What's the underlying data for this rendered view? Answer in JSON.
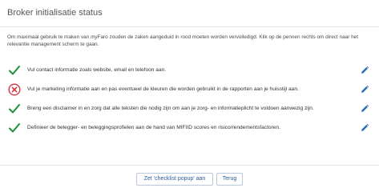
{
  "dialog": {
    "title": "Broker initialisatie status",
    "intro": "Om maximaal gebruik te maken van myFaro zouden de zaken aangeduid in rood moeten worden vervolledigd. Klik op de pennen rechts om direct naar het relevantie management scherm te gaan."
  },
  "checklist": {
    "items": [
      {
        "status": "done",
        "status_icon": "check-icon",
        "text": "Vul contact informatie zoals website, email en telefoon aan."
      },
      {
        "status": "missing",
        "status_icon": "error-circle-icon",
        "text": "Vul je marketing informatie aan en pas eventueel de kleuren die worden gebruikt in de rapporten aan je huisstijl aan."
      },
      {
        "status": "done",
        "status_icon": "check-icon",
        "text": "Breng een disclaimer in en zorg dat alle teksten die nodig zijn om aan je zorg- en informatieplicht te voldoen aanwezig zijn."
      },
      {
        "status": "done",
        "status_icon": "check-icon",
        "text": "Definieer de belegger- en beleggingsprofielen aan de hand van MIFIID scores en risico/rendementsfactoren."
      }
    ]
  },
  "footer": {
    "checklist_button": "Zet 'checklist popup' aan",
    "back_button": "Terug"
  },
  "colors": {
    "done": "#1f8f3a",
    "missing": "#d9343f",
    "edit": "#2d6db5"
  }
}
